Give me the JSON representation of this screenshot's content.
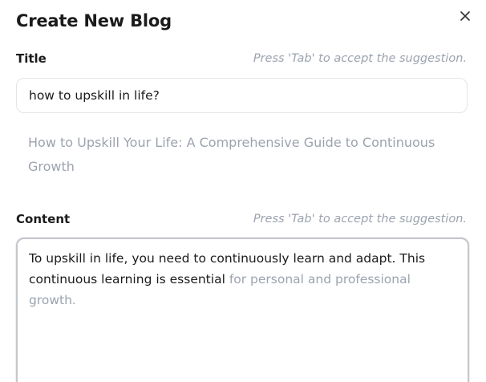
{
  "dialog": {
    "title": "Create New Blog",
    "close_icon": "close-icon"
  },
  "title_field": {
    "label": "Title",
    "hint": "Press 'Tab' to accept the suggestion.",
    "value": "how to upskill in life?",
    "suggestion": "How to Upskill Your Life: A Comprehensive Guide to Continuous Growth"
  },
  "content_field": {
    "label": "Content",
    "hint": "Press 'Tab' to accept the suggestion.",
    "value": "To upskill in life, you need to continuously learn and adapt. This continuous learning is essential ",
    "suggestion": "for personal and professional growth."
  }
}
